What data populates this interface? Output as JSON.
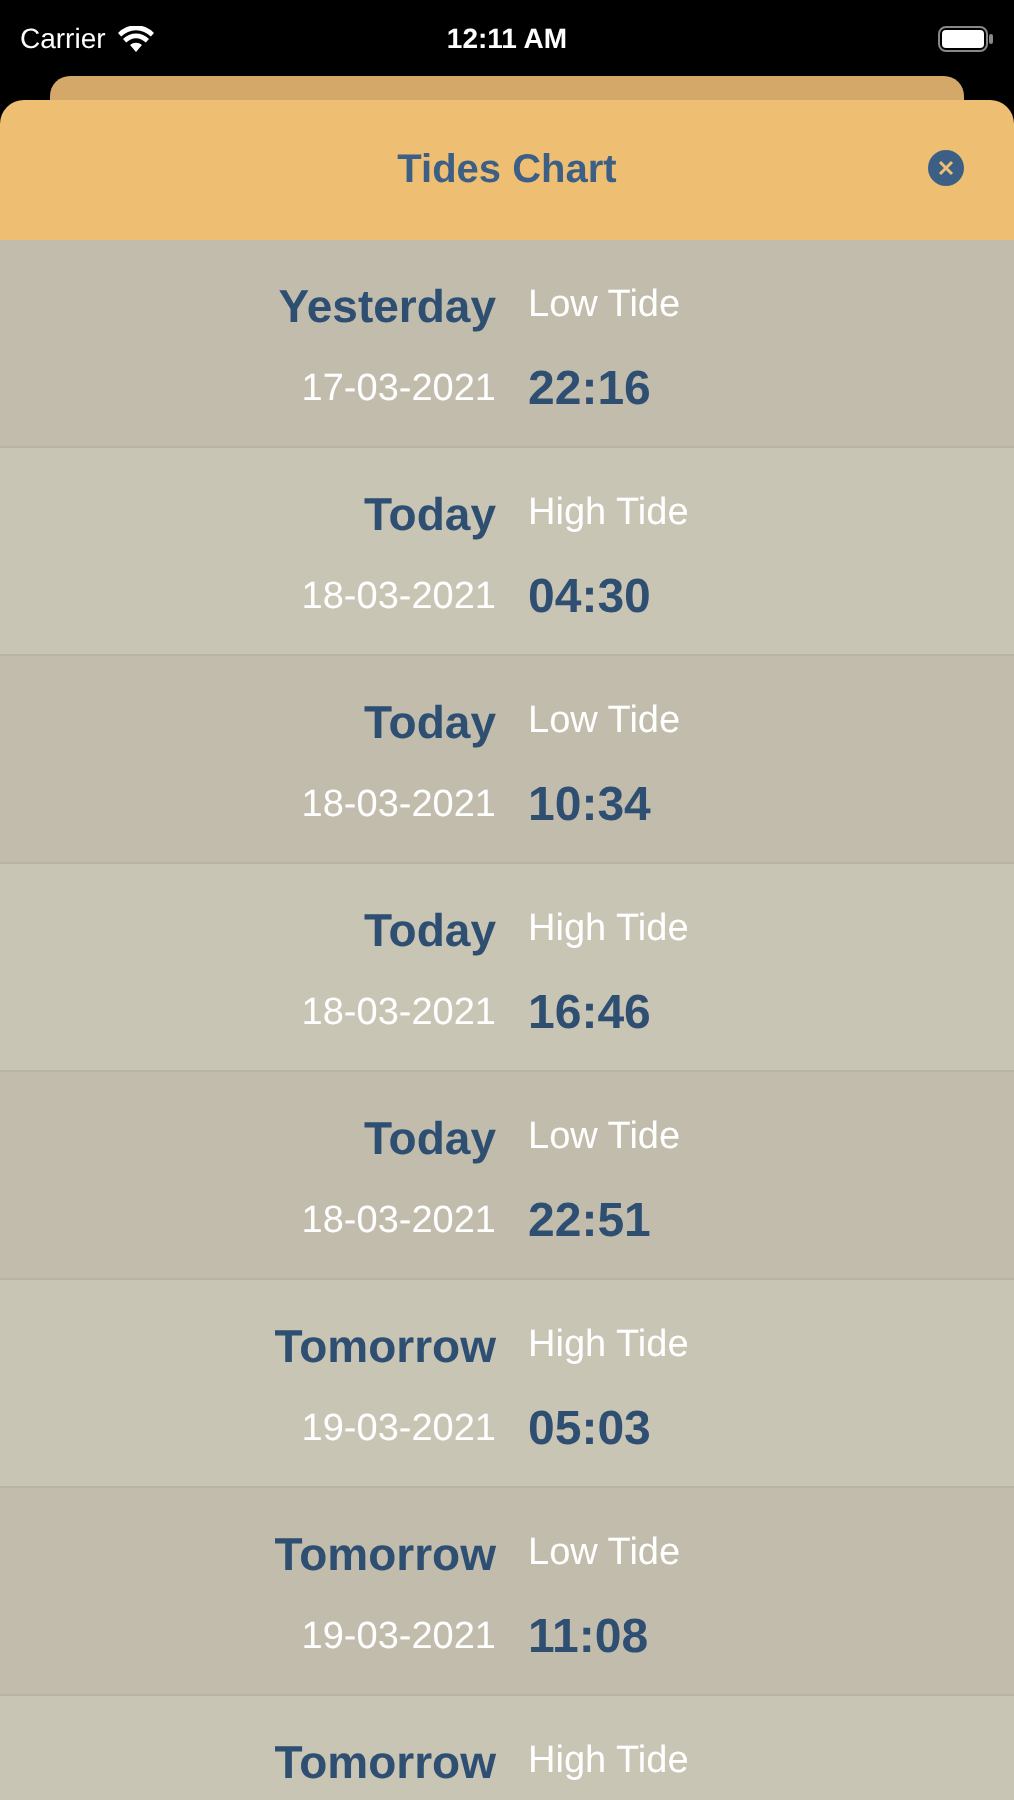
{
  "status_bar": {
    "carrier": "Carrier",
    "time": "12:11 AM"
  },
  "header": {
    "title": "Tides Chart"
  },
  "tides": [
    {
      "day": "Yesterday",
      "type": "Low Tide",
      "date": "17-03-2021",
      "time": "22:16"
    },
    {
      "day": "Today",
      "type": "High Tide",
      "date": "18-03-2021",
      "time": "04:30"
    },
    {
      "day": "Today",
      "type": "Low Tide",
      "date": "18-03-2021",
      "time": "10:34"
    },
    {
      "day": "Today",
      "type": "High Tide",
      "date": "18-03-2021",
      "time": "16:46"
    },
    {
      "day": "Today",
      "type": "Low Tide",
      "date": "18-03-2021",
      "time": "22:51"
    },
    {
      "day": "Tomorrow",
      "type": "High Tide",
      "date": "19-03-2021",
      "time": "05:03"
    },
    {
      "day": "Tomorrow",
      "type": "Low Tide",
      "date": "19-03-2021",
      "time": "11:08"
    },
    {
      "day": "Tomorrow",
      "type": "High Tide"
    }
  ]
}
